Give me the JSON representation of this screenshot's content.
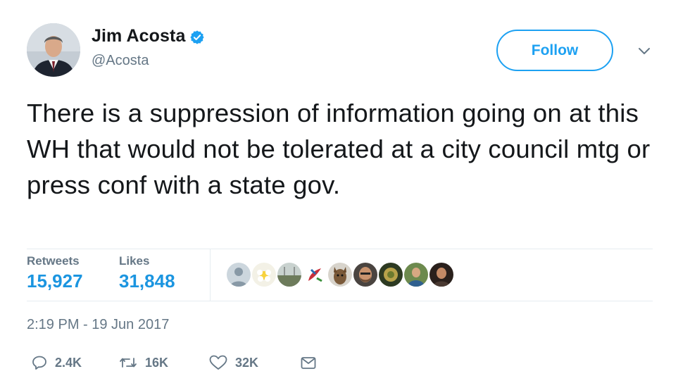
{
  "user": {
    "display_name": "Jim Acosta",
    "handle": "@Acosta",
    "verified": true
  },
  "follow_label": "Follow",
  "tweet_text": "There is a suppression of information going on at this WH that would not be tolerated at a city council mtg or press conf with a state gov.",
  "stats": {
    "retweets_label": "Retweets",
    "retweets_value": "15,927",
    "likes_label": "Likes",
    "likes_value": "31,848"
  },
  "timestamp": "2:19 PM - 19 Jun 2017",
  "actions": {
    "reply_count": "2.4K",
    "retweet_count": "16K",
    "like_count": "32K"
  },
  "colors": {
    "accent": "#1da1f2",
    "link": "#1b95e0",
    "muted": "#657786"
  },
  "icons": [
    "verified-badge-icon",
    "chevron-down-icon",
    "reply-icon",
    "retweet-icon",
    "like-icon",
    "direct-message-icon"
  ]
}
